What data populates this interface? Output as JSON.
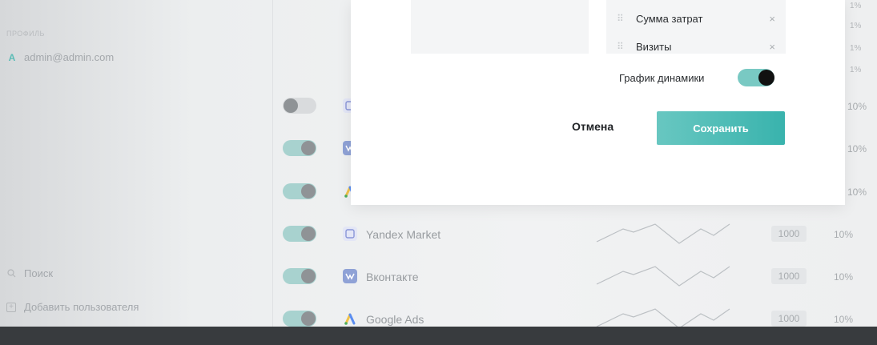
{
  "sidebar": {
    "profile_label": "ПРОФИЛЬ",
    "user_email": "admin@admin.com",
    "user_icon": "A",
    "search_label": "Поиск",
    "add_user_label": "Добавить пользователя"
  },
  "rows": [
    {
      "source": "",
      "icon": "yandex-market-icon",
      "enabled": false,
      "budget": "",
      "percent": "10%"
    },
    {
      "source": "",
      "icon": "vk-icon",
      "enabled": true,
      "budget": "",
      "percent": "10%"
    },
    {
      "source": "",
      "icon": "google-ads-icon",
      "enabled": true,
      "budget": "",
      "percent": "10%"
    },
    {
      "source": "Yandex Market",
      "icon": "yandex-market-icon",
      "enabled": true,
      "budget": "1000",
      "percent": "10%"
    },
    {
      "source": "Вконтакте",
      "icon": "vk-icon",
      "enabled": true,
      "budget": "1000",
      "percent": "10%"
    },
    {
      "source": "Google Ads",
      "icon": "google-ads-icon",
      "enabled": true,
      "budget": "1000",
      "percent": "10%"
    }
  ],
  "edge_percents": [
    "1%",
    "1%",
    "1%",
    "1%"
  ],
  "modal": {
    "metrics": [
      {
        "label": "Сумма затрат",
        "remove": "×"
      },
      {
        "label": "Визиты",
        "remove": "×"
      }
    ],
    "dynamics_label": "График динамики",
    "dynamics_enabled": true,
    "cancel_label": "Отмена",
    "save_label": "Сохранить"
  },
  "colors": {
    "accent": "#3ab3ad",
    "toggle_on": "#a8d2cf",
    "bottom_bar": "#383b3e"
  }
}
